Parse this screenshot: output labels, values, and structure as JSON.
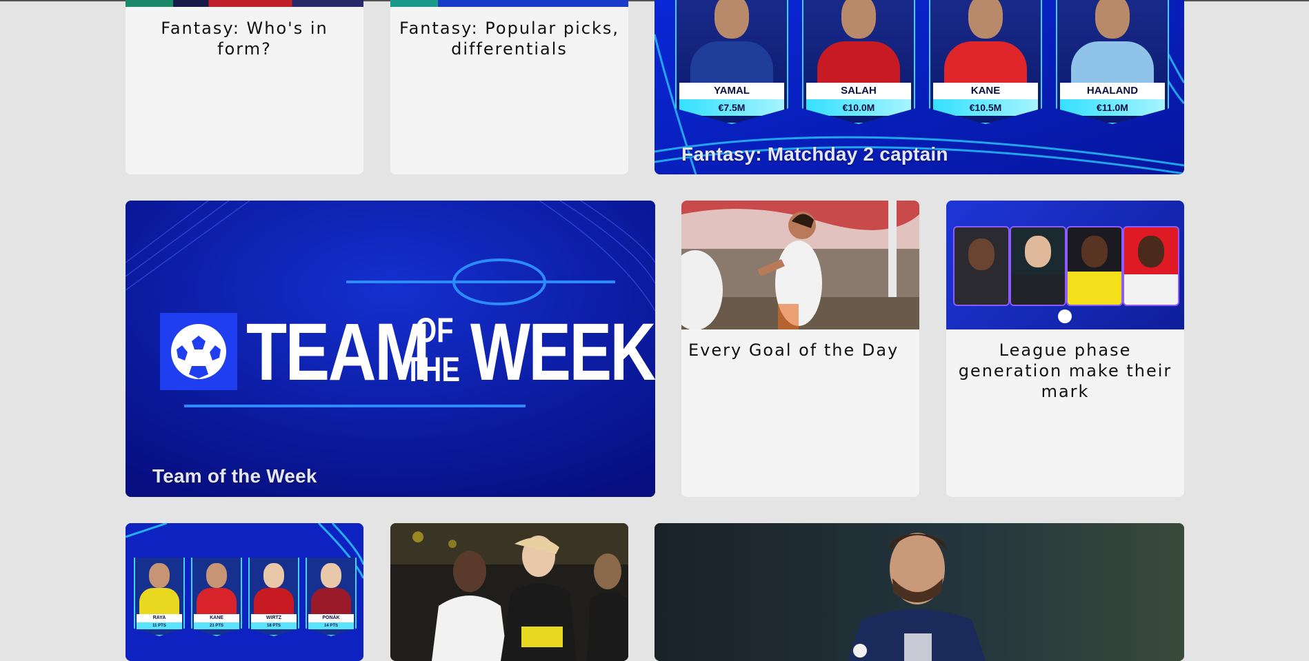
{
  "row1": {
    "card1": {
      "title": "Fantasy: Who's in form?"
    },
    "card2": {
      "title": "Fantasy: Popular picks, differentials"
    },
    "card3": {
      "overlay_title": "Fantasy: Matchday 2 captain",
      "players": [
        {
          "name": "YAMAL",
          "price": "€7.5M",
          "shirt_color": "#1e3e9a"
        },
        {
          "name": "SALAH",
          "price": "€10.0M",
          "shirt_color": "#c81a22"
        },
        {
          "name": "KANE",
          "price": "€10.5M",
          "shirt_color": "#e0252b"
        },
        {
          "name": "HAALAND",
          "price": "€11.0M",
          "shirt_color": "#8fc3ea"
        }
      ]
    }
  },
  "row2": {
    "feature": {
      "overlay_title": "Team of the Week",
      "logo_text_team": "TEAM",
      "logo_text_of": "OF",
      "logo_text_the": "THE",
      "logo_text_week": "WEEK"
    },
    "card_goal": {
      "title": "Every Goal of the Day"
    },
    "card_league": {
      "title": "League phase generation make their mark"
    }
  },
  "row3": {
    "card_team": {
      "players": [
        {
          "name": "RAYA",
          "pts": "11 PTS",
          "shirt_color": "#e8d820"
        },
        {
          "name": "KANE",
          "pts": "21 PTS",
          "shirt_color": "#d8232a"
        },
        {
          "name": "WIRTZ",
          "pts": "18 PTS",
          "shirt_color": "#c81a22"
        },
        {
          "name": "PONÁK",
          "pts": "14 PTS",
          "shirt_color": "#9a1a2a"
        }
      ]
    }
  },
  "colors": {
    "page_bg": "#e4e4e4",
    "card_bg": "#f4f4f4",
    "ucl_blue": "#0a1aa8",
    "ucl_cyan": "#3fd0ff"
  }
}
